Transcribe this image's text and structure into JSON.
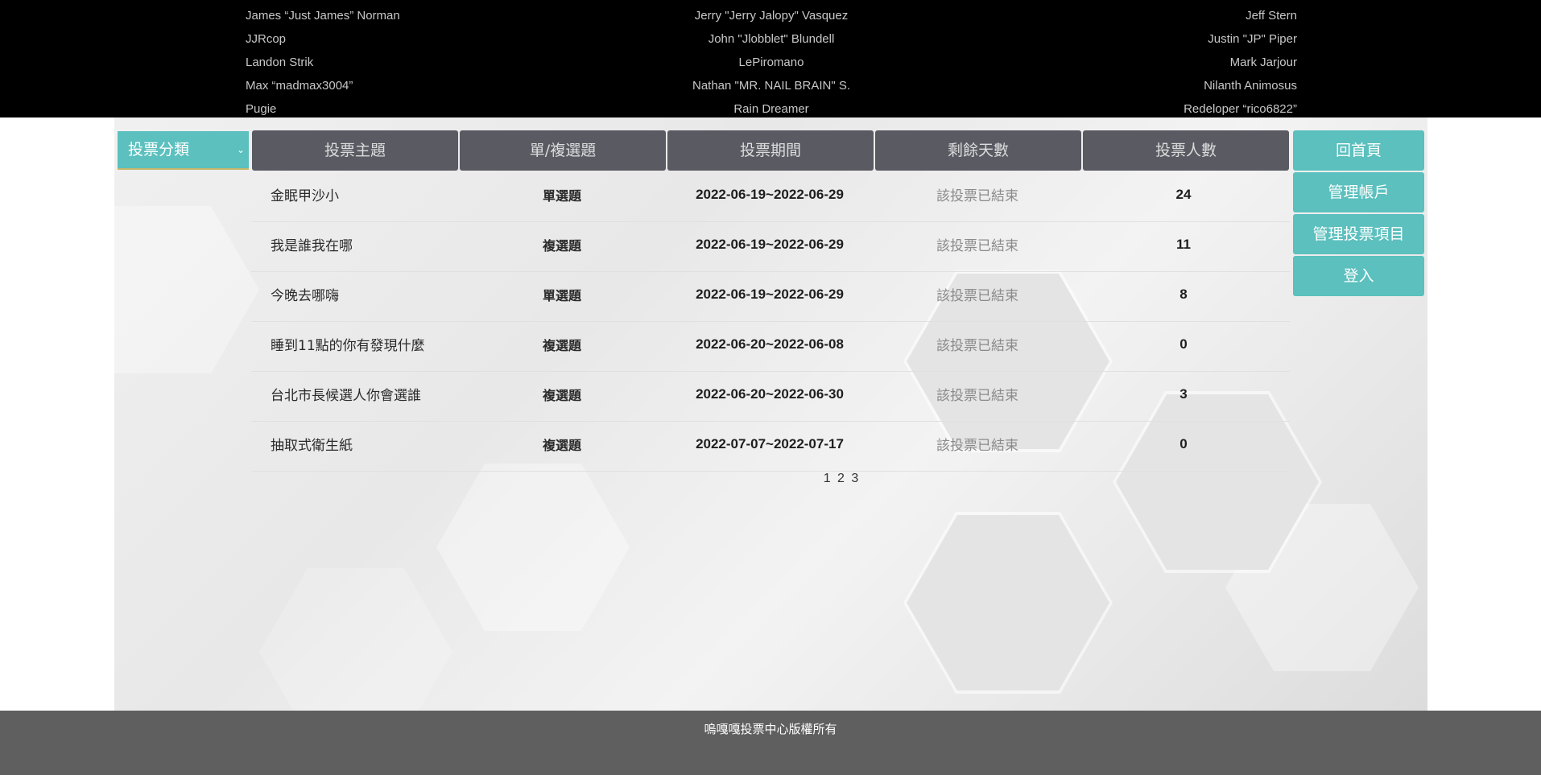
{
  "credits": [
    {
      "left": "James “Just James” Norman",
      "mid": "Jerry \"Jerry Jalopy\" Vasquez",
      "right": "Jeff Stern"
    },
    {
      "left": "JJRcop",
      "mid": "John \"Jlobblet\" Blundell",
      "right": "Justin \"JP\" Piper"
    },
    {
      "left": "Landon Strik",
      "mid": "LePiromano",
      "right": "Mark Jarjour"
    },
    {
      "left": "Max “madmax3004”",
      "mid": "Nathan \"MR. NAIL BRAIN\" S.",
      "right": "Nilanth Animosus"
    },
    {
      "left": "Pugie",
      "mid": "Rain Dreamer",
      "right": "Redeloper “rico6822”"
    }
  ],
  "filter": {
    "category_label": "投票分類"
  },
  "table": {
    "headers": [
      "投票主題",
      "單/複選題",
      "投票期間",
      "剩餘天數",
      "投票人數"
    ],
    "rows": [
      {
        "topic": "金眠甲沙小",
        "type": "單選題",
        "period": "2022-06-19~2022-06-29",
        "remain": "該投票已結束",
        "count": "24"
      },
      {
        "topic": "我是誰我在哪",
        "type": "複選題",
        "period": "2022-06-19~2022-06-29",
        "remain": "該投票已結束",
        "count": "11"
      },
      {
        "topic": "今晚去哪嗨",
        "type": "單選題",
        "period": "2022-06-19~2022-06-29",
        "remain": "該投票已結束",
        "count": "8"
      },
      {
        "topic": "睡到11點的你有發現什麼",
        "type": "複選題",
        "period": "2022-06-20~2022-06-08",
        "remain": "該投票已結束",
        "count": "0"
      },
      {
        "topic": "台北市長候選人你會選誰",
        "type": "複選題",
        "period": "2022-06-20~2022-06-30",
        "remain": "該投票已結束",
        "count": "3"
      },
      {
        "topic": "抽取式衛生紙",
        "type": "複選題",
        "period": "2022-07-07~2022-07-17",
        "remain": "該投票已結束",
        "count": "0"
      }
    ]
  },
  "pagination": {
    "pages": [
      "1",
      "2",
      "3"
    ]
  },
  "side_nav": {
    "home": "回首頁",
    "manage_accounts": "管理帳戶",
    "manage_polls": "管理投票項目",
    "login": "登入"
  },
  "footer": {
    "copyright": "嗚嘎嘎投票中心版權所有"
  },
  "colors": {
    "accent": "#5bc0be",
    "header_bg": "#5a5a63",
    "credits_bg": "#000000",
    "footer_bg": "#5f5f5f"
  }
}
